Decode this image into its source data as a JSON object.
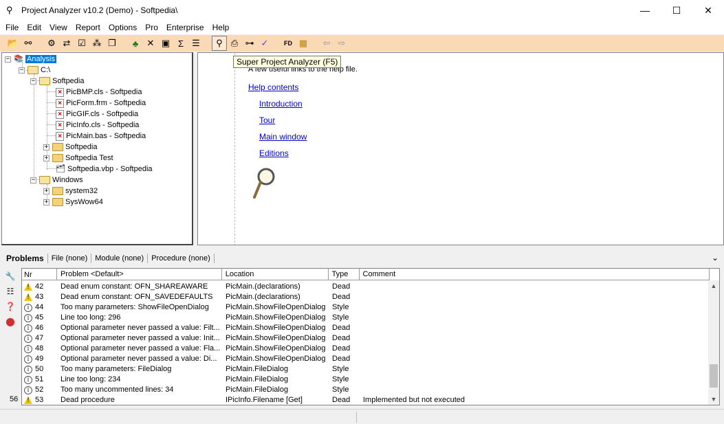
{
  "window": {
    "title": "Project Analyzer v10.2 (Demo) - Softpedia\\",
    "minimize": "—",
    "maximize": "☐",
    "close": "✕"
  },
  "menu": [
    "File",
    "Edit",
    "View",
    "Report",
    "Options",
    "Pro",
    "Enterprise",
    "Help"
  ],
  "toolbar": {
    "tooltip": "Super Project Analyzer (F5)",
    "buttons": [
      "open-icon",
      "binoculars-icon",
      "options-icon",
      "link-icon",
      "check-icon",
      "network-icon",
      "copy-icon",
      "tree-icon",
      "crossref-icon",
      "doc-icon",
      "sigma-icon",
      "list-icon",
      "super-analyzer-icon",
      "print-preview-icon",
      "flow-icon",
      "spellcheck-icon",
      "fd-icon",
      "enterprise-icon",
      "back-icon",
      "forward-icon"
    ]
  },
  "tree": {
    "root": "Analysis",
    "drive": "C:\\",
    "softpedia": "Softpedia",
    "files": [
      "PicBMP.cls - Softpedia",
      "PicForm.frm - Softpedia",
      "PicGIF.cls - Softpedia",
      "PicInfo.cls - Softpedia",
      "PicMain.bas - Softpedia"
    ],
    "subfolder1": "Softpedia",
    "subfolder2": "Softpedia Test",
    "vbp": "Softpedia.vbp - Softpedia",
    "windows": "Windows",
    "system32": "system32",
    "syswow64": "SysWow64"
  },
  "help": {
    "intro": "A few useful links to the help file.",
    "links": [
      "Help contents",
      "Introduction",
      "Tour",
      "Main window",
      "Editions"
    ]
  },
  "problems": {
    "tabs": [
      "Problems",
      "File (none)",
      "Module (none)",
      "Procedure (none)"
    ],
    "columns": [
      "Nr",
      "Problem <Default>",
      "Location",
      "Type",
      "Comment"
    ],
    "count": "56",
    "rows": [
      {
        "icon": "warning",
        "nr": "42",
        "problem": "Dead enum constant: OFN_SHAREAWARE",
        "location": "PicMain.(declarations)",
        "type": "Dead",
        "comment": ""
      },
      {
        "icon": "warning",
        "nr": "43",
        "problem": "Dead enum constant: OFN_SAVEDEFAULTS",
        "location": "PicMain.(declarations)",
        "type": "Dead",
        "comment": ""
      },
      {
        "icon": "info",
        "nr": "44",
        "problem": "Too many parameters: ShowFileOpenDialog",
        "location": "PicMain.ShowFileOpenDialog",
        "type": "Style",
        "comment": ""
      },
      {
        "icon": "info",
        "nr": "45",
        "problem": "Line too long: 296",
        "location": "PicMain.ShowFileOpenDialog",
        "type": "Style",
        "comment": ""
      },
      {
        "icon": "info",
        "nr": "46",
        "problem": "Optional parameter never passed a value: Filt...",
        "location": "PicMain.ShowFileOpenDialog",
        "type": "Dead",
        "comment": ""
      },
      {
        "icon": "info",
        "nr": "47",
        "problem": "Optional parameter never passed a value: Init...",
        "location": "PicMain.ShowFileOpenDialog",
        "type": "Dead",
        "comment": ""
      },
      {
        "icon": "info",
        "nr": "48",
        "problem": "Optional parameter never passed a value: Fla...",
        "location": "PicMain.ShowFileOpenDialog",
        "type": "Dead",
        "comment": ""
      },
      {
        "icon": "info",
        "nr": "49",
        "problem": "Optional parameter never passed a value: Di...",
        "location": "PicMain.ShowFileOpenDialog",
        "type": "Dead",
        "comment": ""
      },
      {
        "icon": "info",
        "nr": "50",
        "problem": "Too many parameters: FileDialog",
        "location": "PicMain.FileDialog",
        "type": "Style",
        "comment": ""
      },
      {
        "icon": "info",
        "nr": "51",
        "problem": "Line too long: 234",
        "location": "PicMain.FileDialog",
        "type": "Style",
        "comment": ""
      },
      {
        "icon": "info",
        "nr": "52",
        "problem": "Too many uncommented lines: 34",
        "location": "PicMain.FileDialog",
        "type": "Style",
        "comment": ""
      },
      {
        "icon": "warning",
        "nr": "53",
        "problem": "Dead procedure",
        "location": "IPicInfo.Filename [Get]",
        "type": "Dead",
        "comment": "Implemented but not executed"
      }
    ]
  },
  "colors": {
    "toolbar_bg": "#f9d9b6",
    "selection": "#0078d7",
    "link": "#0000cc",
    "tooltip_bg": "#ffffe1"
  }
}
